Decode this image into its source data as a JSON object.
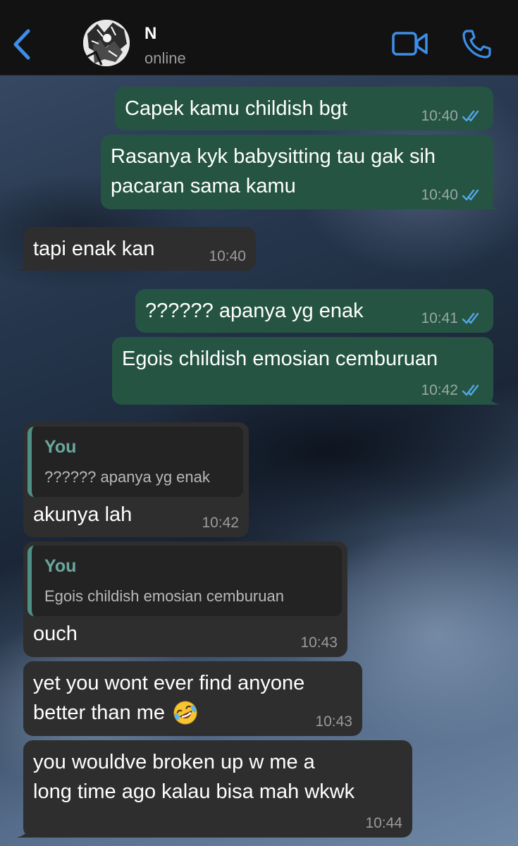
{
  "header": {
    "back_icon": "chevron-left-icon",
    "contact_name": "N",
    "status": "online",
    "video_icon": "video-camera-icon",
    "call_icon": "phone-icon",
    "accent_color": "#3d8ee8"
  },
  "colors": {
    "outgoing_bubble": "#255443",
    "incoming_bubble": "#2e2e2e",
    "quote_author": "#6aa89c",
    "read_ticks": "#53a6e8"
  },
  "messages": [
    {
      "direction": "out",
      "text": "Capek kamu childish bgt",
      "time": "10:40",
      "status": "read"
    },
    {
      "direction": "out",
      "lines": [
        "Rasanya kyk babysitting tau gak sih",
        "pacaran sama kamu"
      ],
      "time": "10:40",
      "status": "read"
    },
    {
      "direction": "in",
      "text": "tapi enak kan",
      "time": "10:40"
    },
    {
      "direction": "out",
      "text": "?????? apanya yg enak",
      "time": "10:41",
      "status": "read"
    },
    {
      "direction": "out",
      "text": "Egois childish emosian cemburuan",
      "time": "10:42",
      "status": "read"
    },
    {
      "direction": "in",
      "reply_to": {
        "author": "You",
        "text": "?????? apanya yg enak"
      },
      "text": "akunya lah",
      "time": "10:42"
    },
    {
      "direction": "in",
      "reply_to": {
        "author": "You",
        "text": "Egois childish emosian cemburuan"
      },
      "text": "ouch",
      "time": "10:43"
    },
    {
      "direction": "in",
      "lines": [
        "yet you wont ever find anyone",
        "better than me"
      ],
      "emoji": "rolling-on-floor-laughing-emoji",
      "time": "10:43"
    },
    {
      "direction": "in",
      "lines": [
        "you wouldve broken up w me a",
        "long time ago kalau bisa mah wkwk"
      ],
      "time": "10:44"
    }
  ]
}
